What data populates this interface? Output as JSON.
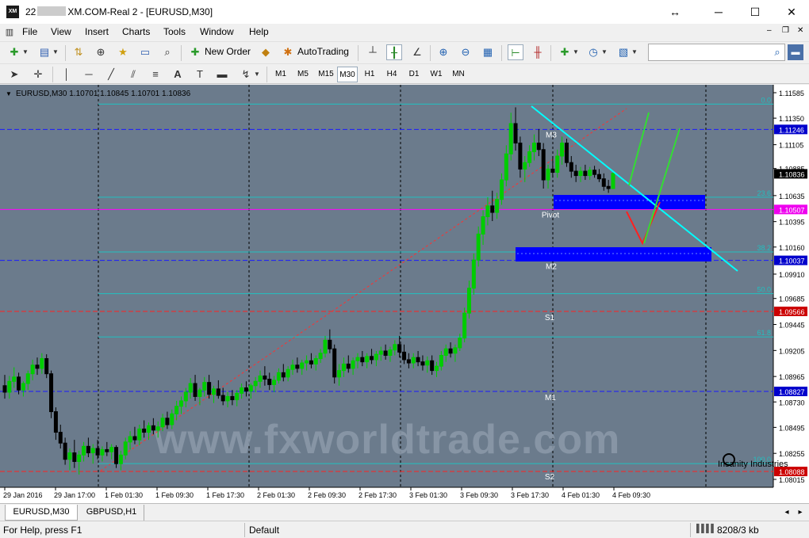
{
  "window": {
    "title_prefix": "22",
    "title_suffix": "XM.COM-Real 2 - [EURUSD,M30]",
    "logo_text": "XM",
    "resize_icon": "↔",
    "minimize": "─",
    "maximize": "☐",
    "close": "✕"
  },
  "menu": [
    "File",
    "View",
    "Insert",
    "Charts",
    "Tools",
    "Window",
    "Help"
  ],
  "mdi": {
    "minimize": "–",
    "restore": "❐",
    "close": "✕"
  },
  "toolbar": {
    "new_order": "New Order",
    "auto_trading": "AutoTrading",
    "search_value": ""
  },
  "timeframes": [
    "M1",
    "M5",
    "M15",
    "M30",
    "H1",
    "H4",
    "D1",
    "W1",
    "MN"
  ],
  "active_timeframe": "M30",
  "chart": {
    "symbol_info": "EURUSD,M30  1.10701 1.10845 1.10701 1.10836",
    "price_labels": [
      "1.11585",
      "1.11350",
      "1.11105",
      "1.10885",
      "1.10635",
      "1.10395",
      "1.10160",
      "1.09910",
      "1.09685",
      "1.09445",
      "1.09205",
      "1.08965",
      "1.08730",
      "1.08495",
      "1.08255",
      "1.08015"
    ],
    "badges": [
      {
        "text": "1.11246",
        "color": "#0000cc"
      },
      {
        "text": "1.10836",
        "color": "#000000"
      },
      {
        "text": "1.10507",
        "color": "#ee00ee"
      },
      {
        "text": "1.10037",
        "color": "#0000cc"
      },
      {
        "text": "1.09566",
        "color": "#cc0000"
      },
      {
        "text": "1.08827",
        "color": "#0000cc"
      },
      {
        "text": "1.08088",
        "color": "#cc0000"
      }
    ],
    "time_labels": [
      "29 Jan 2016",
      "29 Jan 17:00",
      "1 Feb 01:30",
      "1 Feb 09:30",
      "1 Feb 17:30",
      "2 Feb 01:30",
      "2 Feb 09:30",
      "2 Feb 17:30",
      "3 Feb 01:30",
      "3 Feb 09:30",
      "3 Feb 17:30",
      "4 Feb 01:30",
      "4 Feb 09:30"
    ],
    "level_labels": [
      "M3",
      "Pivot",
      "M2",
      "S1",
      "M1",
      "S2"
    ],
    "fib_labels": [
      "0.0",
      "23.6",
      "38.2",
      "50.0",
      "61.8",
      "100.0"
    ],
    "watermark": "www.fxworldtrade.com",
    "stamp": "Insanity Industries",
    "colors": {
      "background": "#6b7b8c",
      "bull_candle": "#00cc00",
      "bear_candle": "#000000",
      "pivot_line": "#ff00ff",
      "m_line": "#1a1aff",
      "s_line": "#ff2020",
      "fib_line": "#20c0c0",
      "trendline": "#00ffff",
      "zone": "#0000ff"
    },
    "candles": [
      {
        "o": 1.0888,
        "h": 1.0898,
        "l": 1.0876,
        "c": 1.0882
      },
      {
        "o": 1.0882,
        "h": 1.0897,
        "l": 1.0876,
        "c": 1.0892
      },
      {
        "o": 1.0892,
        "h": 1.0905,
        "l": 1.0886,
        "c": 1.0896
      },
      {
        "o": 1.0896,
        "h": 1.09,
        "l": 1.088,
        "c": 1.0884
      },
      {
        "o": 1.0884,
        "h": 1.0892,
        "l": 1.0878,
        "c": 1.089
      },
      {
        "o": 1.089,
        "h": 1.0902,
        "l": 1.0884,
        "c": 1.0899
      },
      {
        "o": 1.0899,
        "h": 1.0912,
        "l": 1.0893,
        "c": 1.0907
      },
      {
        "o": 1.0907,
        "h": 1.0914,
        "l": 1.0898,
        "c": 1.0904
      },
      {
        "o": 1.0904,
        "h": 1.0918,
        "l": 1.0899,
        "c": 1.0913
      },
      {
        "o": 1.0913,
        "h": 1.0917,
        "l": 1.0895,
        "c": 1.0899
      },
      {
        "o": 1.0899,
        "h": 1.0902,
        "l": 1.0858,
        "c": 1.0864
      },
      {
        "o": 1.0864,
        "h": 1.0868,
        "l": 1.0838,
        "c": 1.0845
      },
      {
        "o": 1.0845,
        "h": 1.0852,
        "l": 1.083,
        "c": 1.0835
      },
      {
        "o": 1.0835,
        "h": 1.084,
        "l": 1.0815,
        "c": 1.082
      },
      {
        "o": 1.082,
        "h": 1.083,
        "l": 1.081,
        "c": 1.0826
      },
      {
        "o": 1.0826,
        "h": 1.0838,
        "l": 1.0812,
        "c": 1.0818
      },
      {
        "o": 1.0818,
        "h": 1.0828,
        "l": 1.0806,
        "c": 1.0824
      },
      {
        "o": 1.0824,
        "h": 1.0836,
        "l": 1.0818,
        "c": 1.0832
      },
      {
        "o": 1.0832,
        "h": 1.084,
        "l": 1.0822,
        "c": 1.0826
      },
      {
        "o": 1.0826,
        "h": 1.0834,
        "l": 1.0816,
        "c": 1.083
      },
      {
        "o": 1.083,
        "h": 1.0838,
        "l": 1.082,
        "c": 1.0824
      },
      {
        "o": 1.0824,
        "h": 1.0832,
        "l": 1.0818,
        "c": 1.0829
      },
      {
        "o": 1.0829,
        "h": 1.0836,
        "l": 1.0823,
        "c": 1.0827
      },
      {
        "o": 1.0827,
        "h": 1.0834,
        "l": 1.082,
        "c": 1.0831
      },
      {
        "o": 1.0831,
        "h": 1.0833,
        "l": 1.0812,
        "c": 1.0816
      },
      {
        "o": 1.0816,
        "h": 1.0828,
        "l": 1.081,
        "c": 1.0824
      },
      {
        "o": 1.0824,
        "h": 1.084,
        "l": 1.082,
        "c": 1.0836
      },
      {
        "o": 1.0836,
        "h": 1.0846,
        "l": 1.0829,
        "c": 1.0841
      },
      {
        "o": 1.0841,
        "h": 1.085,
        "l": 1.0834,
        "c": 1.0838
      },
      {
        "o": 1.0838,
        "h": 1.0852,
        "l": 1.0833,
        "c": 1.0848
      },
      {
        "o": 1.0848,
        "h": 1.0856,
        "l": 1.084,
        "c": 1.0845
      },
      {
        "o": 1.0845,
        "h": 1.0854,
        "l": 1.0838,
        "c": 1.0851
      },
      {
        "o": 1.0851,
        "h": 1.0858,
        "l": 1.0843,
        "c": 1.0847
      },
      {
        "o": 1.0847,
        "h": 1.0855,
        "l": 1.084,
        "c": 1.085
      },
      {
        "o": 1.085,
        "h": 1.0862,
        "l": 1.0846,
        "c": 1.0858
      },
      {
        "o": 1.0858,
        "h": 1.0864,
        "l": 1.0848,
        "c": 1.0852
      },
      {
        "o": 1.0852,
        "h": 1.0866,
        "l": 1.0848,
        "c": 1.0862
      },
      {
        "o": 1.0862,
        "h": 1.0874,
        "l": 1.0856,
        "c": 1.0869
      },
      {
        "o": 1.0869,
        "h": 1.0878,
        "l": 1.0862,
        "c": 1.0874
      },
      {
        "o": 1.0874,
        "h": 1.0886,
        "l": 1.0868,
        "c": 1.0882
      },
      {
        "o": 1.0882,
        "h": 1.0895,
        "l": 1.0876,
        "c": 1.089
      },
      {
        "o": 1.089,
        "h": 1.0898,
        "l": 1.0874,
        "c": 1.0878
      },
      {
        "o": 1.0878,
        "h": 1.0886,
        "l": 1.087,
        "c": 1.0884
      },
      {
        "o": 1.0884,
        "h": 1.0896,
        "l": 1.0878,
        "c": 1.0891
      },
      {
        "o": 1.0891,
        "h": 1.0898,
        "l": 1.0876,
        "c": 1.088
      },
      {
        "o": 1.088,
        "h": 1.0888,
        "l": 1.0872,
        "c": 1.0885
      },
      {
        "o": 1.0885,
        "h": 1.0893,
        "l": 1.0876,
        "c": 1.0879
      },
      {
        "o": 1.0879,
        "h": 1.0886,
        "l": 1.087,
        "c": 1.0874
      },
      {
        "o": 1.0874,
        "h": 1.0882,
        "l": 1.0868,
        "c": 1.0878
      },
      {
        "o": 1.0878,
        "h": 1.0884,
        "l": 1.087,
        "c": 1.0875
      },
      {
        "o": 1.0875,
        "h": 1.0884,
        "l": 1.0869,
        "c": 1.0881
      },
      {
        "o": 1.0881,
        "h": 1.089,
        "l": 1.0876,
        "c": 1.0886
      },
      {
        "o": 1.0886,
        "h": 1.0892,
        "l": 1.0878,
        "c": 1.0883
      },
      {
        "o": 1.0883,
        "h": 1.089,
        "l": 1.0876,
        "c": 1.0888
      },
      {
        "o": 1.0888,
        "h": 1.0896,
        "l": 1.0882,
        "c": 1.0892
      },
      {
        "o": 1.0892,
        "h": 1.0902,
        "l": 1.0886,
        "c": 1.0897
      },
      {
        "o": 1.0897,
        "h": 1.0906,
        "l": 1.0888,
        "c": 1.0894
      },
      {
        "o": 1.0894,
        "h": 1.09,
        "l": 1.0884,
        "c": 1.0889
      },
      {
        "o": 1.0889,
        "h": 1.0897,
        "l": 1.0882,
        "c": 1.0893
      },
      {
        "o": 1.0893,
        "h": 1.0904,
        "l": 1.089,
        "c": 1.09
      },
      {
        "o": 1.09,
        "h": 1.0908,
        "l": 1.0892,
        "c": 1.0896
      },
      {
        "o": 1.0896,
        "h": 1.0906,
        "l": 1.0892,
        "c": 1.0903
      },
      {
        "o": 1.0903,
        "h": 1.0912,
        "l": 1.0898,
        "c": 1.0907
      },
      {
        "o": 1.0907,
        "h": 1.0914,
        "l": 1.09,
        "c": 1.0904
      },
      {
        "o": 1.0904,
        "h": 1.0912,
        "l": 1.0898,
        "c": 1.0909
      },
      {
        "o": 1.0909,
        "h": 1.0916,
        "l": 1.0902,
        "c": 1.0911
      },
      {
        "o": 1.0911,
        "h": 1.0918,
        "l": 1.0904,
        "c": 1.0908
      },
      {
        "o": 1.0908,
        "h": 1.0916,
        "l": 1.0902,
        "c": 1.0913
      },
      {
        "o": 1.0913,
        "h": 1.0922,
        "l": 1.0909,
        "c": 1.0918
      },
      {
        "o": 1.0918,
        "h": 1.0934,
        "l": 1.0914,
        "c": 1.093
      },
      {
        "o": 1.093,
        "h": 1.094,
        "l": 1.0918,
        "c": 1.0922
      },
      {
        "o": 1.0922,
        "h": 1.0926,
        "l": 1.089,
        "c": 1.0896
      },
      {
        "o": 1.0896,
        "h": 1.0908,
        "l": 1.0888,
        "c": 1.0902
      },
      {
        "o": 1.0902,
        "h": 1.0914,
        "l": 1.0896,
        "c": 1.0908
      },
      {
        "o": 1.0908,
        "h": 1.0916,
        "l": 1.09,
        "c": 1.0904
      },
      {
        "o": 1.0904,
        "h": 1.0914,
        "l": 1.0898,
        "c": 1.0911
      },
      {
        "o": 1.0911,
        "h": 1.0918,
        "l": 1.0904,
        "c": 1.0914
      },
      {
        "o": 1.0914,
        "h": 1.092,
        "l": 1.0906,
        "c": 1.091
      },
      {
        "o": 1.091,
        "h": 1.0918,
        "l": 1.0904,
        "c": 1.0915
      },
      {
        "o": 1.0915,
        "h": 1.0922,
        "l": 1.0908,
        "c": 1.0912
      },
      {
        "o": 1.0912,
        "h": 1.092,
        "l": 1.0906,
        "c": 1.0917
      },
      {
        "o": 1.0917,
        "h": 1.0924,
        "l": 1.0911,
        "c": 1.092
      },
      {
        "o": 1.092,
        "h": 1.0926,
        "l": 1.0912,
        "c": 1.0916
      },
      {
        "o": 1.0916,
        "h": 1.0924,
        "l": 1.091,
        "c": 1.0921
      },
      {
        "o": 1.0921,
        "h": 1.093,
        "l": 1.0916,
        "c": 1.0926
      },
      {
        "o": 1.0926,
        "h": 1.0934,
        "l": 1.0914,
        "c": 1.0919
      },
      {
        "o": 1.0919,
        "h": 1.0926,
        "l": 1.0908,
        "c": 1.0912
      },
      {
        "o": 1.0912,
        "h": 1.0918,
        "l": 1.0904,
        "c": 1.0909
      },
      {
        "o": 1.0909,
        "h": 1.0918,
        "l": 1.0904,
        "c": 1.0914
      },
      {
        "o": 1.0914,
        "h": 1.092,
        "l": 1.0906,
        "c": 1.091
      },
      {
        "o": 1.091,
        "h": 1.0916,
        "l": 1.0902,
        "c": 1.0907
      },
      {
        "o": 1.0907,
        "h": 1.0915,
        "l": 1.09,
        "c": 1.0911
      },
      {
        "o": 1.0911,
        "h": 1.0916,
        "l": 1.0898,
        "c": 1.0902
      },
      {
        "o": 1.0902,
        "h": 1.091,
        "l": 1.0896,
        "c": 1.0906
      },
      {
        "o": 1.0906,
        "h": 1.092,
        "l": 1.0902,
        "c": 1.0916
      },
      {
        "o": 1.0916,
        "h": 1.0926,
        "l": 1.091,
        "c": 1.0922
      },
      {
        "o": 1.0922,
        "h": 1.0928,
        "l": 1.0914,
        "c": 1.0918
      },
      {
        "o": 1.0918,
        "h": 1.0926,
        "l": 1.091,
        "c": 1.0923
      },
      {
        "o": 1.0923,
        "h": 1.0936,
        "l": 1.092,
        "c": 1.0932
      },
      {
        "o": 1.0932,
        "h": 1.096,
        "l": 1.0928,
        "c": 1.0955
      },
      {
        "o": 1.0955,
        "h": 1.0985,
        "l": 1.095,
        "c": 1.0978
      },
      {
        "o": 1.0978,
        "h": 1.101,
        "l": 1.0972,
        "c": 1.1004
      },
      {
        "o": 1.1004,
        "h": 1.1035,
        "l": 1.0998,
        "c": 1.1028
      },
      {
        "o": 1.1028,
        "h": 1.105,
        "l": 1.1018,
        "c": 1.1044
      },
      {
        "o": 1.1044,
        "h": 1.1062,
        "l": 1.1036,
        "c": 1.1054
      },
      {
        "o": 1.1054,
        "h": 1.1068,
        "l": 1.104,
        "c": 1.1048
      },
      {
        "o": 1.1048,
        "h": 1.1066,
        "l": 1.1042,
        "c": 1.106
      },
      {
        "o": 1.106,
        "h": 1.1084,
        "l": 1.1055,
        "c": 1.1078
      },
      {
        "o": 1.1078,
        "h": 1.111,
        "l": 1.1072,
        "c": 1.1102
      },
      {
        "o": 1.1102,
        "h": 1.114,
        "l": 1.1096,
        "c": 1.113
      },
      {
        "o": 1.113,
        "h": 1.1145,
        "l": 1.1105,
        "c": 1.1112
      },
      {
        "o": 1.1112,
        "h": 1.1118,
        "l": 1.108,
        "c": 1.1088
      },
      {
        "o": 1.1088,
        "h": 1.11,
        "l": 1.1076,
        "c": 1.1094
      },
      {
        "o": 1.1094,
        "h": 1.111,
        "l": 1.109,
        "c": 1.1104
      },
      {
        "o": 1.1104,
        "h": 1.112,
        "l": 1.1096,
        "c": 1.1112
      },
      {
        "o": 1.1112,
        "h": 1.1125,
        "l": 1.11,
        "c": 1.1106
      },
      {
        "o": 1.1106,
        "h": 1.1112,
        "l": 1.107,
        "c": 1.1078
      },
      {
        "o": 1.1078,
        "h": 1.1092,
        "l": 1.107,
        "c": 1.1088
      },
      {
        "o": 1.1088,
        "h": 1.11,
        "l": 1.108,
        "c": 1.1085
      },
      {
        "o": 1.1085,
        "h": 1.1106,
        "l": 1.108,
        "c": 1.11
      },
      {
        "o": 1.11,
        "h": 1.1118,
        "l": 1.1092,
        "c": 1.1112
      },
      {
        "o": 1.1112,
        "h": 1.1116,
        "l": 1.109,
        "c": 1.1094
      },
      {
        "o": 1.1094,
        "h": 1.11,
        "l": 1.108,
        "c": 1.1086
      },
      {
        "o": 1.1086,
        "h": 1.1092,
        "l": 1.1076,
        "c": 1.1082
      },
      {
        "o": 1.1082,
        "h": 1.109,
        "l": 1.1076,
        "c": 1.1086
      },
      {
        "o": 1.1086,
        "h": 1.1092,
        "l": 1.1078,
        "c": 1.1082
      },
      {
        "o": 1.1082,
        "h": 1.109,
        "l": 1.1078,
        "c": 1.1087
      },
      {
        "o": 1.1087,
        "h": 1.1091,
        "l": 1.108,
        "c": 1.1083
      },
      {
        "o": 1.1083,
        "h": 1.1088,
        "l": 1.1076,
        "c": 1.1079
      },
      {
        "o": 1.1079,
        "h": 1.1084,
        "l": 1.1068,
        "c": 1.1072
      },
      {
        "o": 1.1072,
        "h": 1.1078,
        "l": 1.1066,
        "c": 1.107
      },
      {
        "o": 1.107,
        "h": 1.1085,
        "l": 1.107,
        "c": 1.1084
      }
    ]
  },
  "tabs": [
    "EURUSD,M30",
    "GBPUSD,H1"
  ],
  "status": {
    "help": "For Help, press F1",
    "profile": "Default",
    "traffic": "8208/3 kb"
  }
}
